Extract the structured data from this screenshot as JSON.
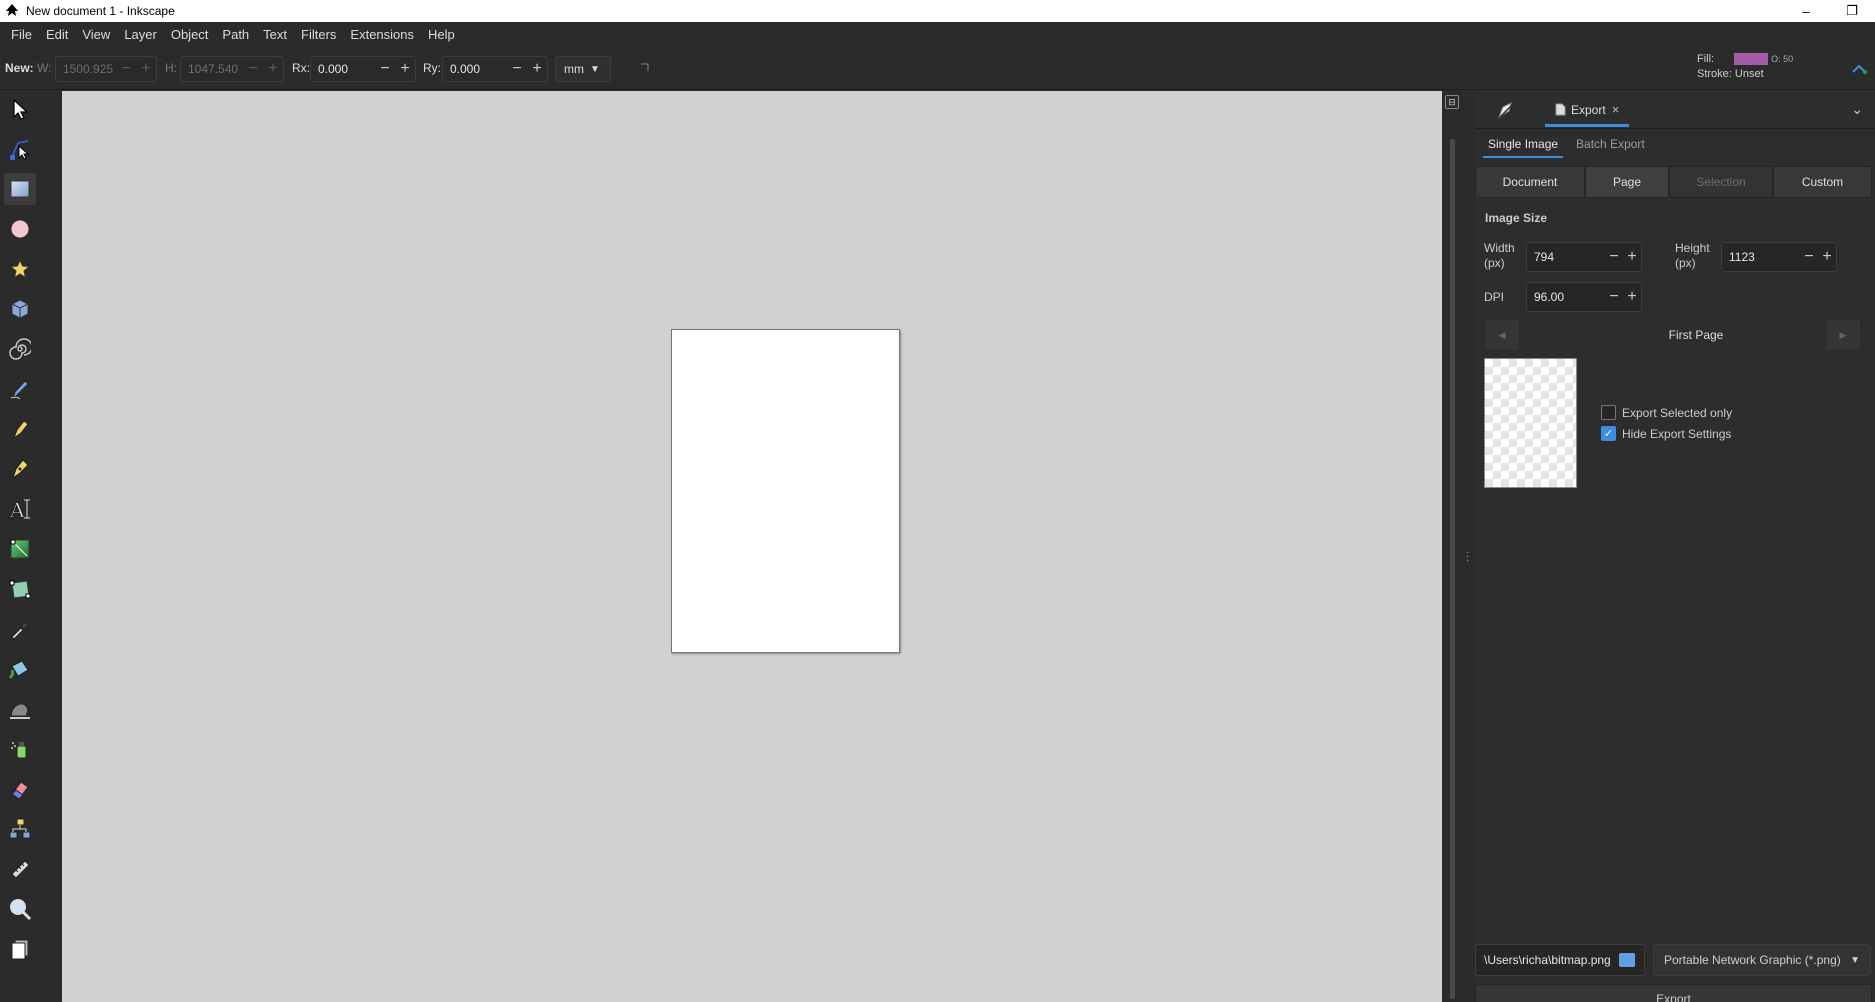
{
  "window": {
    "title": "New document 1 - Inkscape",
    "minimize": "–",
    "restore": "❐"
  },
  "menubar": [
    "File",
    "Edit",
    "View",
    "Layer",
    "Object",
    "Path",
    "Text",
    "Filters",
    "Extensions",
    "Help"
  ],
  "toolbar": {
    "new_label": "New:",
    "w_label": "W:",
    "w_value": "1500.925",
    "h_label": "H:",
    "h_value": "1047.540",
    "rx_label": "Rx:",
    "rx_value": "0.000",
    "ry_label": "Ry:",
    "ry_value": "0.000",
    "unit": "mm",
    "fill_label": "Fill:",
    "stroke_label": "Stroke:",
    "stroke_value": "Unset",
    "opacity_label": "O:",
    "opacity_value": "50",
    "fill_color": "#a45ca8"
  },
  "tools": [
    "selector-icon",
    "node-icon",
    "rectangle-icon",
    "circle-icon",
    "star-icon",
    "box3d-icon",
    "spiral-icon",
    "pencil-icon",
    "pen-icon",
    "calligraphy-icon",
    "text-icon",
    "gradient-icon",
    "mesh-icon",
    "dropper-icon",
    "paint-bucket-icon",
    "tweak-icon",
    "spray-icon",
    "eraser-icon",
    "connector-icon",
    "measure-icon",
    "zoom-icon",
    "pages-icon"
  ],
  "panel": {
    "tab_label": "Export",
    "tab_close": "×",
    "menu_caret": "⌄",
    "sub_tabs": [
      "Single Image",
      "Batch Export"
    ],
    "area_tabs": [
      "Document",
      "Page",
      "Selection",
      "Custom"
    ],
    "image_size_title": "Image Size",
    "width_label": "Width",
    "width_unit": "(px)",
    "width_value": "794",
    "height_label": "Height",
    "height_unit": "(px)",
    "height_value": "1123",
    "dpi_label": "DPI",
    "dpi_value": "96.00",
    "page_label": "First Page",
    "export_selected_only": "Export Selected only",
    "hide_export_settings": "Hide Export Settings",
    "filename": "\\Users\\richa\\bitmap.png",
    "filetype": "Portable Network Graphic (*.png)",
    "export_button": "Export"
  }
}
